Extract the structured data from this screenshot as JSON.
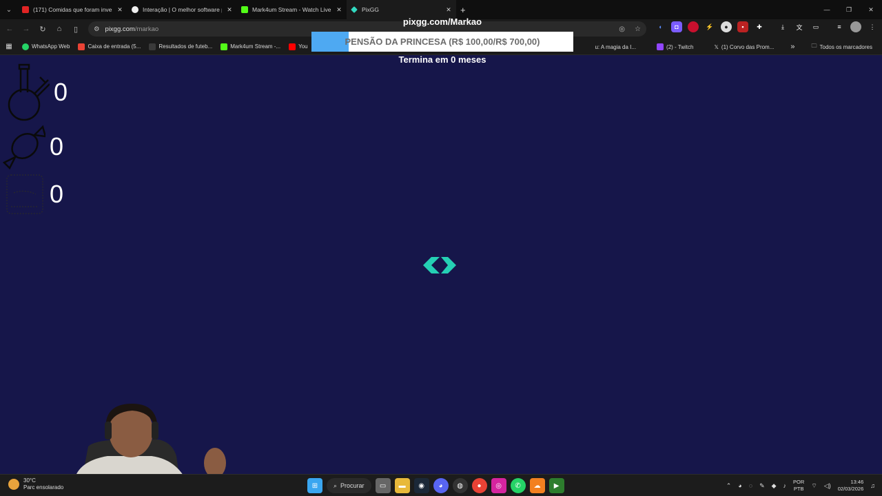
{
  "browser": {
    "tabs": [
      {
        "title": "(171) Comidas que foram inven",
        "favicon_color": "#e02424",
        "active": false
      },
      {
        "title": "Interação | O melhor software p",
        "favicon_color": "#f0f0f0",
        "active": false
      },
      {
        "title": "Mark4um Stream - Watch Live c",
        "favicon_color": "#53fc18",
        "active": false
      },
      {
        "title": "PixGG",
        "favicon_color": "#32d9c0",
        "active": true
      }
    ],
    "address": {
      "domain": "pixgg.com",
      "path": "/markao"
    },
    "bookmarks": [
      {
        "label": "WhatsApp Web",
        "color": "#25d366"
      },
      {
        "label": "Caixa de entrada (5...",
        "color": "#ea4335"
      },
      {
        "label": "Resultados de futeb...",
        "color": "#3a3a3a"
      },
      {
        "label": "Mark4um Stream -...",
        "color": "#53fc18"
      },
      {
        "label": "You",
        "color": "#ff0000"
      }
    ],
    "bookmarks_right": [
      {
        "label": "u: A magia da I...",
        "color": "#444"
      },
      {
        "label": "(2) - Twitch",
        "color": "#9146ff"
      },
      {
        "label": "(1) Corvo das Prom...",
        "color": "#111"
      }
    ],
    "all_bookmarks_label": "Todos os marcadores"
  },
  "overlay": {
    "domain_label": "pixgg.com/Markao",
    "goal_text": "PENSÃO DA PRINCESA (R$ 100,00/R$ 700,00)",
    "goal_progress": 0.143,
    "goal_fill_color": "#4ea9f2",
    "time_left": "Termina em 0 meses",
    "counters": [
      {
        "icon": "bong-icon",
        "value": "0"
      },
      {
        "icon": "candy-icon",
        "value": "0"
      },
      {
        "icon": "jar-icon",
        "value": "0"
      }
    ],
    "logo_color": "#25d0b4",
    "background": "#16164a"
  },
  "taskbar": {
    "weather_temp": "30°C",
    "weather_desc": "Parc ensolarado",
    "search_label": "Procurar",
    "lang_line1": "POR",
    "lang_line2": "PTB",
    "time": "13:46",
    "date": "02/03/2026"
  }
}
